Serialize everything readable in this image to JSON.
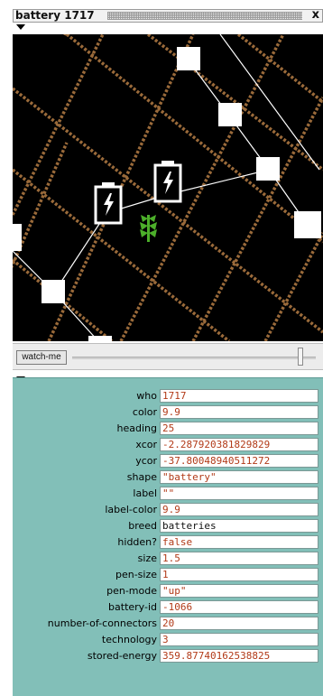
{
  "window": {
    "title": "battery 1717",
    "close_glyph": "x"
  },
  "watch_button": "watch-me",
  "colors": {
    "view_bg": "#000000",
    "grid_brown": "#9a6a3a",
    "props_bg": "#82bfb8",
    "value_text": "#b23a18",
    "plant_green": "#4caf2a"
  },
  "icons": [
    "collapse-arrow-icon",
    "battery-icon",
    "plant-icon"
  ],
  "properties": [
    {
      "name": "who",
      "value": "1717"
    },
    {
      "name": "color",
      "value": "9.9"
    },
    {
      "name": "heading",
      "value": "25"
    },
    {
      "name": "xcor",
      "value": "-2.287920381829829"
    },
    {
      "name": "ycor",
      "value": "-37.80048940511272"
    },
    {
      "name": "shape",
      "value": "\"battery\""
    },
    {
      "name": "label",
      "value": "\"\""
    },
    {
      "name": "label-color",
      "value": "9.9"
    },
    {
      "name": "breed",
      "value": "batteries"
    },
    {
      "name": "hidden?",
      "value": "false"
    },
    {
      "name": "size",
      "value": "1.5"
    },
    {
      "name": "pen-size",
      "value": "1"
    },
    {
      "name": "pen-mode",
      "value": "\"up\""
    },
    {
      "name": "battery-id",
      "value": "-1066"
    },
    {
      "name": "number-of-connectors",
      "value": "20"
    },
    {
      "name": "technology",
      "value": "3"
    },
    {
      "name": "stored-energy",
      "value": "359.87740162538825"
    }
  ]
}
